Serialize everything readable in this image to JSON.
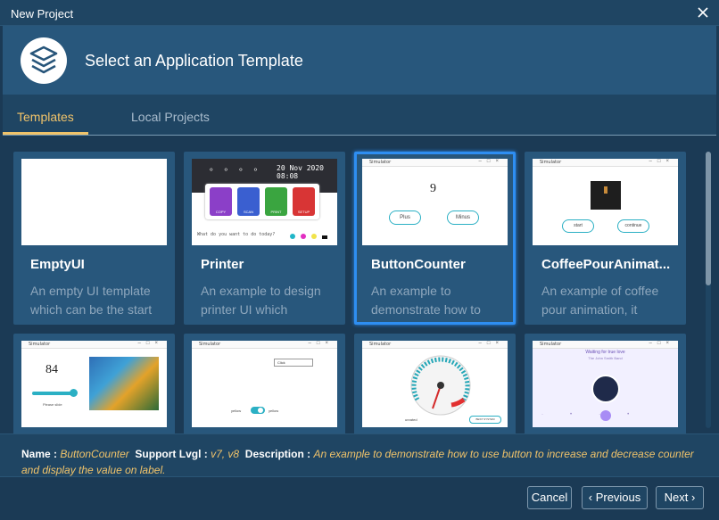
{
  "window": {
    "title": "New Project"
  },
  "header": {
    "title": "Select an Application Template",
    "logo_icon": "layers-icon"
  },
  "tabs": [
    {
      "label": "Templates",
      "active": true
    },
    {
      "label": "Local Projects",
      "active": false
    }
  ],
  "templates": [
    {
      "name": "EmptyUI",
      "description": "An empty UI template which can be the start",
      "selected": false
    },
    {
      "name": "Printer",
      "description": "An example to design printer UI which",
      "selected": false,
      "preview": {
        "time": "20 Nov 2020 08:08",
        "question": "What do you want to do today?",
        "tiles": [
          "COPY",
          "SCAN",
          "PRINT",
          "SETUP"
        ]
      }
    },
    {
      "name": "ButtonCounter",
      "description": "An example to demonstrate how to",
      "selected": true,
      "preview": {
        "window_title": "Simulator",
        "count": "9",
        "plus": "Plus",
        "minus": "Minus"
      }
    },
    {
      "name": "CoffeePourAnimat...",
      "description": "An example of coffee pour animation, it",
      "selected": false,
      "preview": {
        "window_title": "Simulator",
        "start": "start",
        "continue": "continue"
      }
    },
    {
      "name": "",
      "description": "",
      "preview": {
        "window_title": "Simulator",
        "value": "84",
        "caption": "Please slide"
      }
    },
    {
      "name": "",
      "description": "",
      "preview": {
        "window_title": "Simulator",
        "dropdown": "Click",
        "toggle_left": "yellow",
        "toggle_right": "yellow"
      }
    },
    {
      "name": "",
      "description": "",
      "preview": {
        "window_title": "Simulator",
        "label": "unrated",
        "button": "BEST SYSTEM"
      }
    },
    {
      "name": "",
      "description": "",
      "preview": {
        "window_title": "Simulator",
        "song": "Waiting for true love",
        "artist": "The John Smith Band"
      }
    }
  ],
  "info": {
    "name_label": "Name :",
    "name_value": "ButtonCounter",
    "support_label": "Support Lvgl :",
    "support_value": "v7, v8",
    "description_label": "Description :",
    "description_value": "An example to demonstrate how to use button to increase and decrease counter and display the value on label."
  },
  "footer": {
    "cancel": "Cancel",
    "previous": "Previous",
    "next": "Next"
  },
  "colors": {
    "accent": "#f0c36a",
    "selection": "#2e8ef2",
    "panel": "#28577c",
    "background": "#1b3a55"
  }
}
